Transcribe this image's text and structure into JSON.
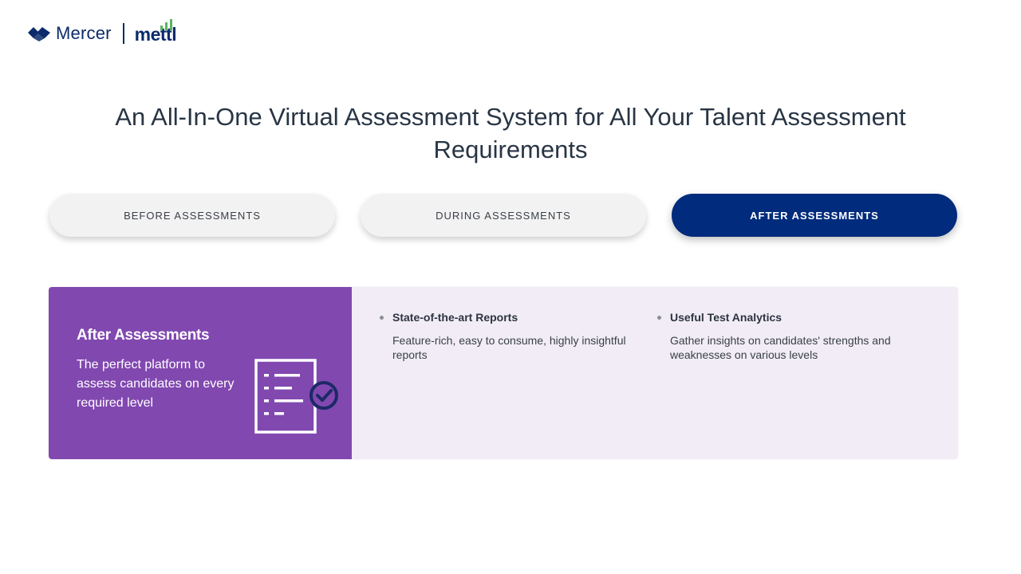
{
  "header": {
    "brand_primary": "Mercer",
    "brand_secondary": "mettl",
    "brand_color": "#0b2b6b",
    "accent_green": "#5ab55e"
  },
  "main": {
    "heading_line1": "An All-In-One Virtual Assessment System for All Your Talent Assessment",
    "heading_line2": "Requirements"
  },
  "tabs": [
    {
      "label": "BEFORE ASSESSMENTS",
      "active": false
    },
    {
      "label": "DURING ASSESSMENTS",
      "active": false
    },
    {
      "label": "AFTER ASSESSMENTS",
      "active": true
    }
  ],
  "colors": {
    "active_tab": "#012b7c",
    "inactive_tab": "#f2f2f2",
    "panel_left": "#8148b0",
    "panel_right": "#f1ecf6",
    "icon_check": "#1c2a66"
  },
  "panel": {
    "title": "After Assessments",
    "description": "The perfect platform to assess candidates on every required level",
    "icon": "checklist-check-icon",
    "features": [
      {
        "title": "State-of-the-art Reports",
        "description": "Feature-rich, easy to consume, highly insightful reports"
      },
      {
        "title": "Useful Test Analytics",
        "description": "Gather insights on candidates' strengths and weaknesses on various levels"
      }
    ]
  }
}
